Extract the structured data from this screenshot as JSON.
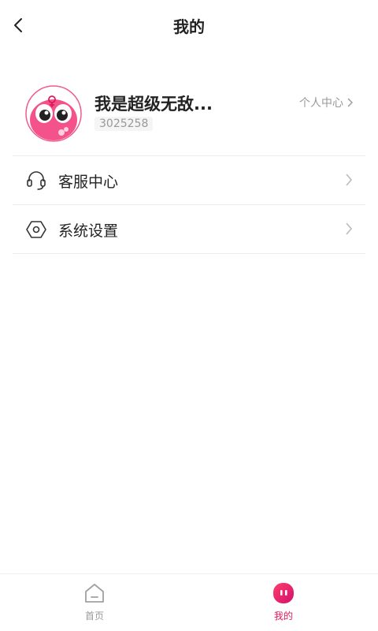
{
  "header": {
    "title": "我的"
  },
  "profile": {
    "name": "我是超级无敌...",
    "uid": "3025258",
    "personal_center": "个人中心"
  },
  "menu": [
    {
      "label": "客服中心",
      "icon": "headset-icon"
    },
    {
      "label": "系统设置",
      "icon": "settings-hexagon-icon"
    }
  ],
  "tabbar": {
    "home": {
      "label": "首页",
      "icon": "home-icon",
      "color": "#9a9a9a"
    },
    "mine": {
      "label": "我的",
      "icon": "mine-icon",
      "color": "#e0185a"
    }
  },
  "colors": {
    "accent": "#e0185a",
    "text_secondary": "#999999"
  }
}
